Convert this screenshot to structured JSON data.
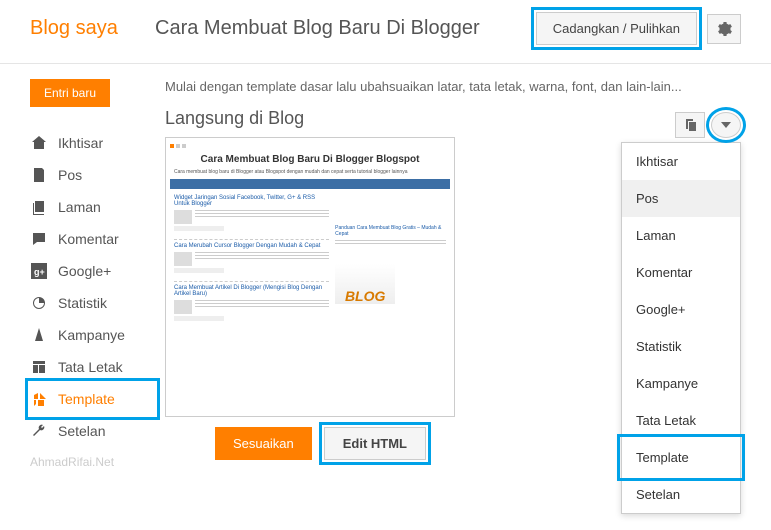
{
  "header": {
    "brand": "Blog saya",
    "title": "Cara Membuat Blog Baru Di Blogger",
    "backup_label": "Cadangkan / Pulihkan"
  },
  "sidebar": {
    "new_entry": "Entri baru",
    "items": [
      {
        "label": "Ikhtisar"
      },
      {
        "label": "Pos"
      },
      {
        "label": "Laman"
      },
      {
        "label": "Komentar"
      },
      {
        "label": "Google+"
      },
      {
        "label": "Statistik"
      },
      {
        "label": "Kampanye"
      },
      {
        "label": "Tata Letak"
      },
      {
        "label": "Template"
      },
      {
        "label": "Setelan"
      }
    ],
    "watermark": "AhmadRifai.Net"
  },
  "main": {
    "intro": "Mulai dengan template dasar lalu ubahsuaikan latar, tata letak, warna, font, dan lain-lain...",
    "section_title": "Langsung di Blog",
    "customize_label": "Sesuaikan",
    "edit_html_label": "Edit HTML"
  },
  "preview": {
    "title": "Cara Membuat Blog Baru Di Blogger Blogspot",
    "subtitle": "Cara membuat blog baru di Blogger atau Blogspot dengan mudah dan cepat serta tutorial blogger lainnya",
    "posts": [
      {
        "title": "Widget Jaringan Sosial Facebook, Twitter, G+ & RSS Untuk Blogger"
      },
      {
        "title": "Cara Merubah Cursor Blogger Dengan Mudah & Cepat"
      },
      {
        "title": "Cara Membuat Artikel Di Blogger (Mengisi Blog Dengan Artikel Baru)"
      }
    ],
    "sidebar_text": "Panduan Cara Membuat Blog Gratis – Mudah & Cepat"
  },
  "dropdown": {
    "items": [
      {
        "label": "Ikhtisar"
      },
      {
        "label": "Pos"
      },
      {
        "label": "Laman"
      },
      {
        "label": "Komentar"
      },
      {
        "label": "Google+"
      },
      {
        "label": "Statistik"
      },
      {
        "label": "Kampanye"
      },
      {
        "label": "Tata Letak"
      },
      {
        "label": "Template"
      },
      {
        "label": "Setelan"
      }
    ]
  }
}
